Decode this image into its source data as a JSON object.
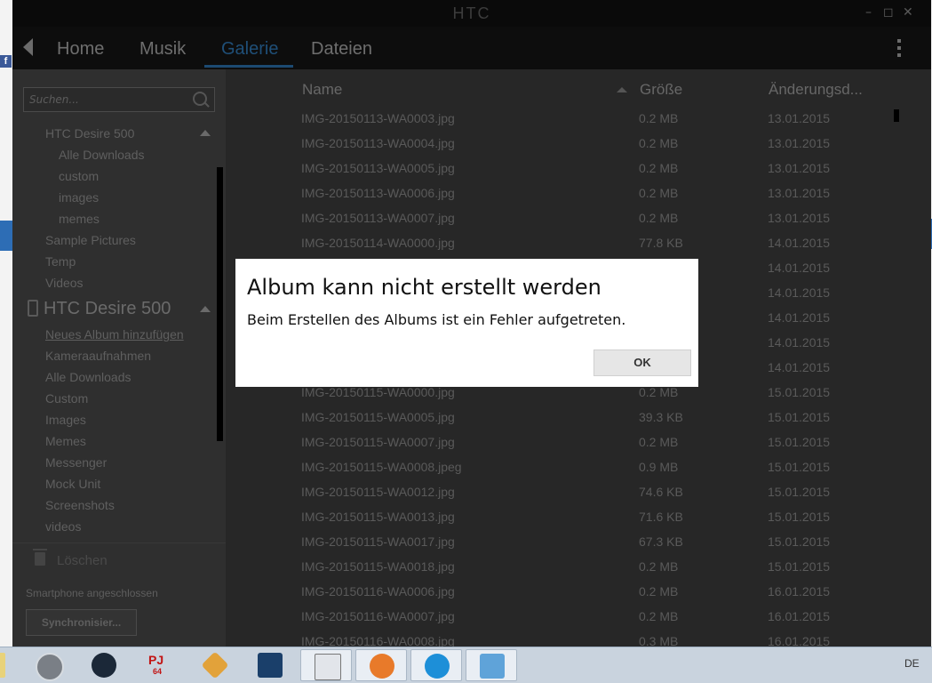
{
  "window": {
    "title": "HTC"
  },
  "nav": {
    "tabs": [
      {
        "label": "Home"
      },
      {
        "label": "Musik"
      },
      {
        "label": "Galerie"
      },
      {
        "label": "Dateien"
      }
    ],
    "active_tab": "Galerie"
  },
  "sidebar": {
    "search_placeholder": "Suchen...",
    "tree1": {
      "header": "HTC Desire 500",
      "children": [
        "Alle Downloads",
        "custom",
        "images",
        "memes"
      ],
      "siblings": [
        "Sample Pictures",
        "Temp",
        "Videos"
      ]
    },
    "device": {
      "header": "HTC Desire 500",
      "items": [
        "Neues Album hinzufügen",
        "Kameraaufnahmen",
        "Alle Downloads",
        "Custom",
        "Images",
        "Memes",
        "Messenger",
        "Mock Unit",
        "Screenshots",
        "videos"
      ]
    },
    "delete_label": "Löschen",
    "status": "Smartphone angeschlossen",
    "sync_label": "Synchronisier..."
  },
  "list": {
    "headers": {
      "name": "Name",
      "size": "Größe",
      "date": "Änderungsd..."
    },
    "rows": [
      {
        "name": "IMG-20150113-WA0003.jpg",
        "size": "0.2 MB",
        "date": "13.01.2015"
      },
      {
        "name": "IMG-20150113-WA0004.jpg",
        "size": "0.2 MB",
        "date": "13.01.2015"
      },
      {
        "name": "IMG-20150113-WA0005.jpg",
        "size": "0.2 MB",
        "date": "13.01.2015"
      },
      {
        "name": "IMG-20150113-WA0006.jpg",
        "size": "0.2 MB",
        "date": "13.01.2015"
      },
      {
        "name": "IMG-20150113-WA0007.jpg",
        "size": "0.2 MB",
        "date": "13.01.2015"
      },
      {
        "name": "IMG-20150114-WA0000.jpg",
        "size": "77.8 KB",
        "date": "14.01.2015"
      },
      {
        "name": "",
        "size": "",
        "date": "14.01.2015"
      },
      {
        "name": "",
        "size": "",
        "date": "14.01.2015"
      },
      {
        "name": "",
        "size": "",
        "date": "14.01.2015"
      },
      {
        "name": "",
        "size": "",
        "date": "14.01.2015"
      },
      {
        "name": "",
        "size": "",
        "date": "14.01.2015"
      },
      {
        "name": "IMG-20150115-WA0000.jpg",
        "size": "0.2 MB",
        "date": "15.01.2015"
      },
      {
        "name": "IMG-20150115-WA0005.jpg",
        "size": "39.3 KB",
        "date": "15.01.2015"
      },
      {
        "name": "IMG-20150115-WA0007.jpg",
        "size": "0.2 MB",
        "date": "15.01.2015"
      },
      {
        "name": "IMG-20150115-WA0008.jpeg",
        "size": "0.9 MB",
        "date": "15.01.2015"
      },
      {
        "name": "IMG-20150115-WA0012.jpg",
        "size": "74.6 KB",
        "date": "15.01.2015"
      },
      {
        "name": "IMG-20150115-WA0013.jpg",
        "size": "71.6 KB",
        "date": "15.01.2015"
      },
      {
        "name": "IMG-20150115-WA0017.jpg",
        "size": "67.3 KB",
        "date": "15.01.2015"
      },
      {
        "name": "IMG-20150115-WA0018.jpg",
        "size": "0.2 MB",
        "date": "15.01.2015"
      },
      {
        "name": "IMG-20150116-WA0006.jpg",
        "size": "0.2 MB",
        "date": "16.01.2015"
      },
      {
        "name": "IMG-20150116-WA0007.jpg",
        "size": "0.2 MB",
        "date": "16.01.2015"
      },
      {
        "name": "IMG-20150116-WA0008.jpg",
        "size": "0.3 MB",
        "date": "16.01.2015"
      }
    ]
  },
  "dialog": {
    "title": "Album kann nicht erstellt werden",
    "message": "Beim Erstellen des Albums ist ein Fehler aufgetreten.",
    "ok_label": "OK"
  },
  "taskbar": {
    "apps": [
      "notepad-icon",
      "media-player-icon",
      "steam-icon",
      "project64-icon",
      "winamp-icon",
      "app-icon",
      "file-manager-icon",
      "firefox-icon",
      "htc-sync-icon",
      "control-panel-icon"
    ],
    "pj_label": "PJ",
    "pj_sub": "64",
    "language": "DE"
  },
  "background": {
    "fb_glyph": "f"
  }
}
